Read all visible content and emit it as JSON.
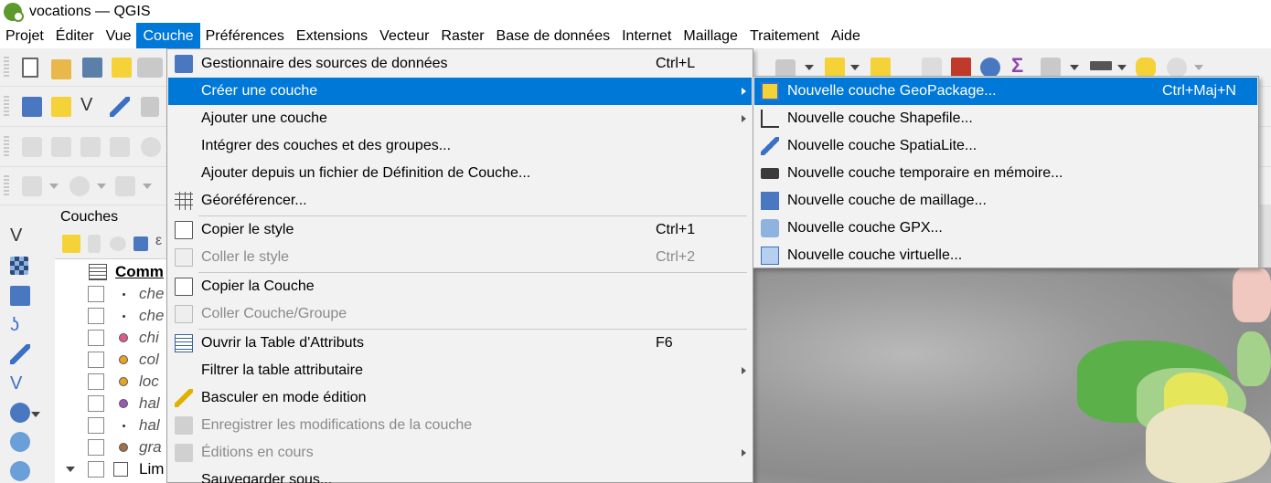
{
  "window": {
    "title": "vocations — QGIS"
  },
  "menubar": [
    {
      "label": "Projet",
      "active": false
    },
    {
      "label": "Éditer",
      "active": false
    },
    {
      "label": "Vue",
      "active": false
    },
    {
      "label": "Couche",
      "active": true
    },
    {
      "label": "Préférences",
      "active": false
    },
    {
      "label": "Extensions",
      "active": false
    },
    {
      "label": "Vecteur",
      "active": false
    },
    {
      "label": "Raster",
      "active": false
    },
    {
      "label": "Base de données",
      "active": false
    },
    {
      "label": "Internet",
      "active": false
    },
    {
      "label": "Maillage",
      "active": false
    },
    {
      "label": "Traitement",
      "active": false
    },
    {
      "label": "Aide",
      "active": false
    }
  ],
  "layers_panel": {
    "title": "Couches",
    "group_label": "Comm",
    "group_icon": "attribute-table-icon",
    "layers": [
      {
        "name": "che",
        "symbol": "dot"
      },
      {
        "name": "che",
        "symbol": "dot"
      },
      {
        "name": "chi",
        "symbol": "circle",
        "color": "#e05a8a"
      },
      {
        "name": "col",
        "symbol": "circle",
        "color": "#e8a321"
      },
      {
        "name": "loc",
        "symbol": "circle",
        "color": "#e8a321"
      },
      {
        "name": "hal",
        "symbol": "circle",
        "color": "#9b59b6"
      },
      {
        "name": "hal",
        "symbol": "dot"
      },
      {
        "name": "gra",
        "symbol": "circle",
        "color": "#a0704a"
      }
    ],
    "bottom_layer": "Lim"
  },
  "couche_menu": {
    "items": [
      {
        "label": "Gestionnaire des sources de données",
        "shortcut": "Ctrl+L",
        "icon": "data-source-manager-icon",
        "disabled": false,
        "submenu": false,
        "highlighted": false
      },
      {
        "label": "Créer une couche",
        "shortcut": "",
        "icon": "",
        "disabled": false,
        "submenu": true,
        "highlighted": true
      },
      {
        "label": "Ajouter une couche",
        "shortcut": "",
        "icon": "",
        "disabled": false,
        "submenu": true,
        "highlighted": false
      },
      {
        "label": "Intégrer des couches et des groupes...",
        "shortcut": "",
        "icon": "",
        "disabled": false,
        "submenu": false,
        "highlighted": false
      },
      {
        "label": "Ajouter depuis un fichier de Définition de Couche...",
        "shortcut": "",
        "icon": "",
        "disabled": false,
        "submenu": false,
        "highlighted": false
      },
      {
        "label": "Géoréférencer...",
        "shortcut": "",
        "icon": "georeferencer-icon",
        "disabled": false,
        "submenu": false,
        "highlighted": false
      },
      {
        "label": "Copier le style",
        "shortcut": "Ctrl+1",
        "icon": "copy-style-icon",
        "disabled": false,
        "submenu": false,
        "highlighted": false
      },
      {
        "label": "Coller le style",
        "shortcut": "Ctrl+2",
        "icon": "paste-style-icon",
        "disabled": true,
        "submenu": false,
        "highlighted": false
      },
      {
        "label": "Copier la Couche",
        "shortcut": "",
        "icon": "copy-layer-icon",
        "disabled": false,
        "submenu": false,
        "highlighted": false
      },
      {
        "label": "Coller Couche/Groupe",
        "shortcut": "",
        "icon": "paste-layer-icon",
        "disabled": true,
        "submenu": false,
        "highlighted": false
      },
      {
        "label": "Ouvrir la Table d'Attributs",
        "shortcut": "F6",
        "icon": "attribute-table-icon",
        "disabled": false,
        "submenu": false,
        "highlighted": false
      },
      {
        "label": "Filtrer la table attributaire",
        "shortcut": "",
        "icon": "",
        "disabled": false,
        "submenu": true,
        "highlighted": false
      },
      {
        "label": "Basculer en mode édition",
        "shortcut": "",
        "icon": "pencil-icon",
        "disabled": false,
        "submenu": false,
        "highlighted": false
      },
      {
        "label": "Enregistrer les modifications de la couche",
        "shortcut": "",
        "icon": "save-edits-icon",
        "disabled": true,
        "submenu": false,
        "highlighted": false
      },
      {
        "label": "Éditions en cours",
        "shortcut": "",
        "icon": "current-edits-icon",
        "disabled": true,
        "submenu": true,
        "highlighted": false
      },
      {
        "label": "Sauvegarder sous...",
        "shortcut": "",
        "icon": "",
        "disabled": false,
        "submenu": false,
        "highlighted": false
      }
    ]
  },
  "create_submenu": {
    "items": [
      {
        "label": "Nouvelle couche GeoPackage...",
        "shortcut": "Ctrl+Maj+N",
        "icon": "geopackage-icon",
        "highlighted": true
      },
      {
        "label": "Nouvelle couche Shapefile...",
        "shortcut": "",
        "icon": "shapefile-icon",
        "highlighted": false
      },
      {
        "label": "Nouvelle couche SpatiaLite...",
        "shortcut": "",
        "icon": "spatialite-feather-icon",
        "highlighted": false
      },
      {
        "label": "Nouvelle couche temporaire en mémoire...",
        "shortcut": "",
        "icon": "memory-layer-icon",
        "highlighted": false
      },
      {
        "label": "Nouvelle couche de maillage...",
        "shortcut": "",
        "icon": "mesh-layer-icon",
        "highlighted": false
      },
      {
        "label": "Nouvelle couche GPX...",
        "shortcut": "",
        "icon": "gpx-icon",
        "highlighted": false
      },
      {
        "label": "Nouvelle couche virtuelle...",
        "shortcut": "",
        "icon": "virtual-layer-icon",
        "highlighted": false
      }
    ]
  },
  "colors": {
    "accent": "#0078d7",
    "disabled_text": "#8a8a8a",
    "map_green": "#4caf50",
    "map_lightgreen": "#a5d28a",
    "map_yellow": "#e6e65a",
    "map_pink": "#f0c8c0"
  }
}
